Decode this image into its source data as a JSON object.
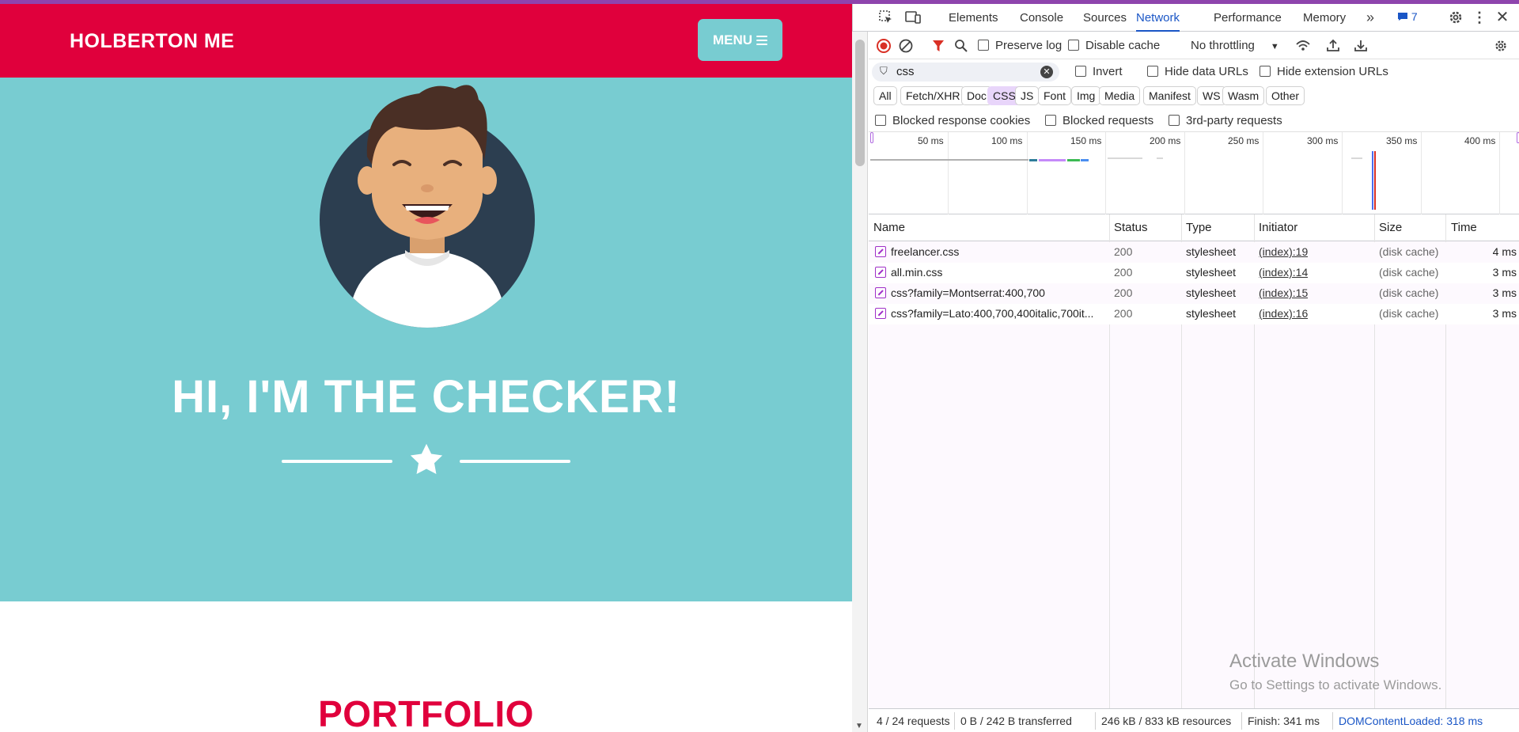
{
  "site": {
    "brand": "HOLBERTON ME",
    "menu_label": "MENU",
    "hero_title": "HI, I'M THE CHECKER!",
    "section_title": "PORTFOLIO",
    "colors": {
      "nav": "#e0003c",
      "masthead": "#78ccd1",
      "accent": "#e0003c"
    }
  },
  "devtools": {
    "tabs": [
      "Elements",
      "Console",
      "Sources",
      "Network",
      "Performance",
      "Memory"
    ],
    "active_tab": "Network",
    "issues_count": "7",
    "toolbar": {
      "preserve_log": "Preserve log",
      "disable_cache": "Disable cache",
      "throttling": "No throttling"
    },
    "filter": {
      "value": "css",
      "invert": "Invert",
      "hide_data_urls": "Hide data URLs",
      "hide_extension_urls": "Hide extension URLs"
    },
    "type_filters": [
      "All",
      "Fetch/XHR",
      "Doc",
      "CSS",
      "JS",
      "Font",
      "Img",
      "Media",
      "Manifest",
      "WS",
      "Wasm",
      "Other"
    ],
    "selected_type": "CSS",
    "extra_filters": [
      "Blocked response cookies",
      "Blocked requests",
      "3rd-party requests"
    ],
    "timeline_ticks": [
      "50 ms",
      "100 ms",
      "150 ms",
      "200 ms",
      "250 ms",
      "300 ms",
      "350 ms",
      "400 ms"
    ],
    "columns": [
      "Name",
      "Status",
      "Type",
      "Initiator",
      "Size",
      "Time"
    ],
    "requests": [
      {
        "name": "freelancer.css",
        "status": "200",
        "type": "stylesheet",
        "initiator": "(index):19",
        "size": "(disk cache)",
        "time": "4 ms"
      },
      {
        "name": "all.min.css",
        "status": "200",
        "type": "stylesheet",
        "initiator": "(index):14",
        "size": "(disk cache)",
        "time": "3 ms"
      },
      {
        "name": "css?family=Montserrat:400,700",
        "status": "200",
        "type": "stylesheet",
        "initiator": "(index):15",
        "size": "(disk cache)",
        "time": "3 ms"
      },
      {
        "name": "css?family=Lato:400,700,400italic,700it...",
        "status": "200",
        "type": "stylesheet",
        "initiator": "(index):16",
        "size": "(disk cache)",
        "time": "3 ms"
      }
    ],
    "status_bar": {
      "requests": "4 / 24 requests",
      "transferred": "0 B / 242 B transferred",
      "resources": "246 kB / 833 kB resources",
      "finish": "Finish: 341 ms",
      "dom_content_loaded": "DOMContentLoaded: 318 ms"
    },
    "watermark": {
      "line1": "Activate Windows",
      "line2": "Go to Settings to activate Windows."
    }
  }
}
